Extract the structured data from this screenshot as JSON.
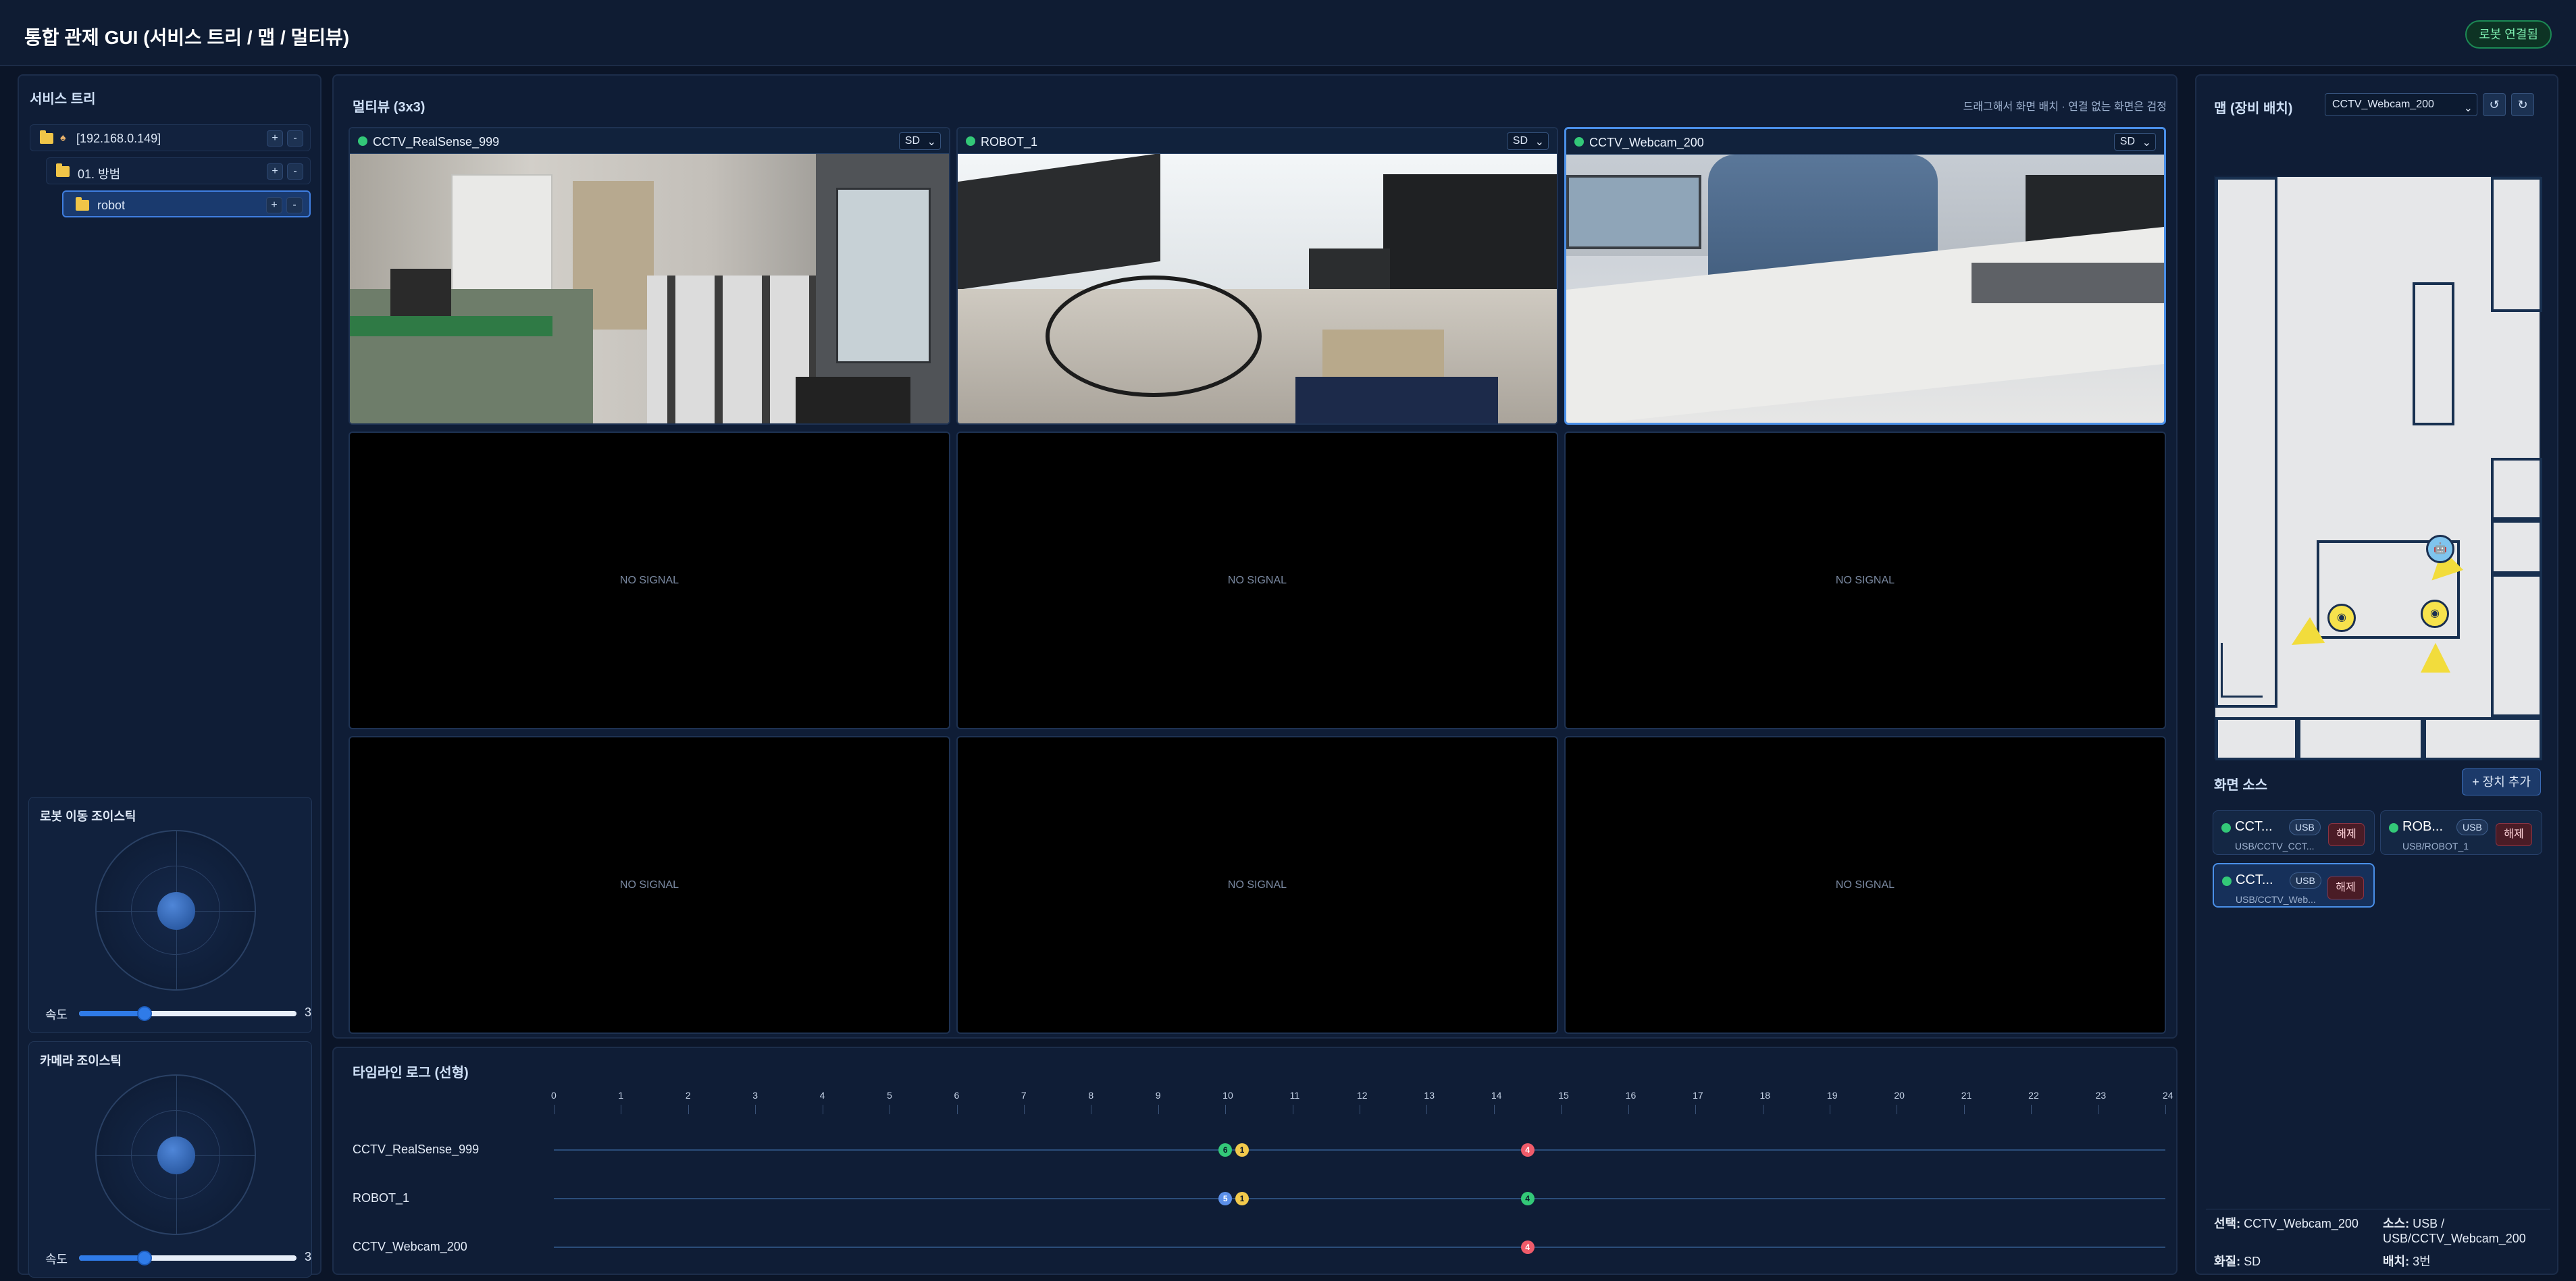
{
  "header": {
    "title": "통합 관제 GUI (서비스 트리 / 맵 / 멀티뷰)",
    "status": "로봇 연결됨"
  },
  "tree": {
    "title": "서비스 트리",
    "add_label": "+",
    "remove_label": "-",
    "items": [
      {
        "label": "[192.168.0.149]"
      },
      {
        "label": "01. 방범"
      },
      {
        "label": "robot"
      }
    ]
  },
  "joystick_move": {
    "title": "로봇 이동 조이스틱",
    "speed_label": "속도",
    "speed_value": "3",
    "speed_fraction": 0.3
  },
  "joystick_camera": {
    "title": "카메라 조이스틱",
    "speed_label": "속도",
    "speed_value": "3",
    "speed_fraction": 0.3
  },
  "multiview": {
    "title": "멀티뷰 (3x3)",
    "hint": "드래그해서 화면 배치 · 연결 없는 화면은 검정",
    "no_signal": "NO SIGNAL",
    "cells": [
      {
        "name": "CCTV_RealSense_999",
        "quality": "SD"
      },
      {
        "name": "ROBOT_1",
        "quality": "SD"
      },
      {
        "name": "CCTV_Webcam_200",
        "quality": "SD"
      }
    ]
  },
  "timeline": {
    "title": "타임라인 로그 (선형)",
    "ticks": [
      "0",
      "1",
      "2",
      "3",
      "4",
      "5",
      "6",
      "7",
      "8",
      "9",
      "10",
      "11",
      "12",
      "13",
      "14",
      "15",
      "16",
      "17",
      "18",
      "19",
      "20",
      "21",
      "22",
      "23",
      "24"
    ],
    "rows": [
      {
        "label": "CCTV_RealSense_999",
        "events": [
          {
            "t": 10.0,
            "color": "green",
            "text": "6"
          },
          {
            "t": 10.25,
            "color": "yellow",
            "text": "1"
          },
          {
            "t": 14.5,
            "color": "red",
            "text": "4"
          }
        ]
      },
      {
        "label": "ROBOT_1",
        "events": [
          {
            "t": 10.0,
            "color": "blue",
            "text": "5"
          },
          {
            "t": 10.25,
            "color": "yellow",
            "text": "1"
          },
          {
            "t": 14.5,
            "color": "green",
            "text": "4"
          }
        ]
      },
      {
        "label": "CCTV_Webcam_200",
        "events": [
          {
            "t": 14.5,
            "color": "red",
            "text": "4"
          }
        ]
      }
    ]
  },
  "map": {
    "title": "맵 (장비 배치)",
    "selected_device": "CCTV_Webcam_200",
    "reset_icon": "↺",
    "refresh_icon": "↻"
  },
  "sources": {
    "title": "화면 소스",
    "add_button": "+ 장치 추가",
    "release_label": "해제",
    "items": [
      {
        "name": "CCT...",
        "type": "USB",
        "path": "USB/CCTV_CCT..."
      },
      {
        "name": "ROB...",
        "type": "USB",
        "path": "USB/ROBOT_1"
      },
      {
        "name": "CCT...",
        "type": "USB",
        "path": "USB/CCTV_Web..."
      }
    ]
  },
  "selection_info": {
    "selected_label": "선택:",
    "selected_value": "CCTV_Webcam_200",
    "source_label": "소스:",
    "source_value_1": "USB /",
    "source_value_2": "USB/CCTV_Webcam_200",
    "quality_label": "화질:",
    "quality_value": "SD",
    "slot_label": "배치:",
    "slot_value": "3번"
  },
  "colors": {
    "accent": "#2f7be8",
    "live": "#33c878",
    "background": "#0b1528"
  }
}
